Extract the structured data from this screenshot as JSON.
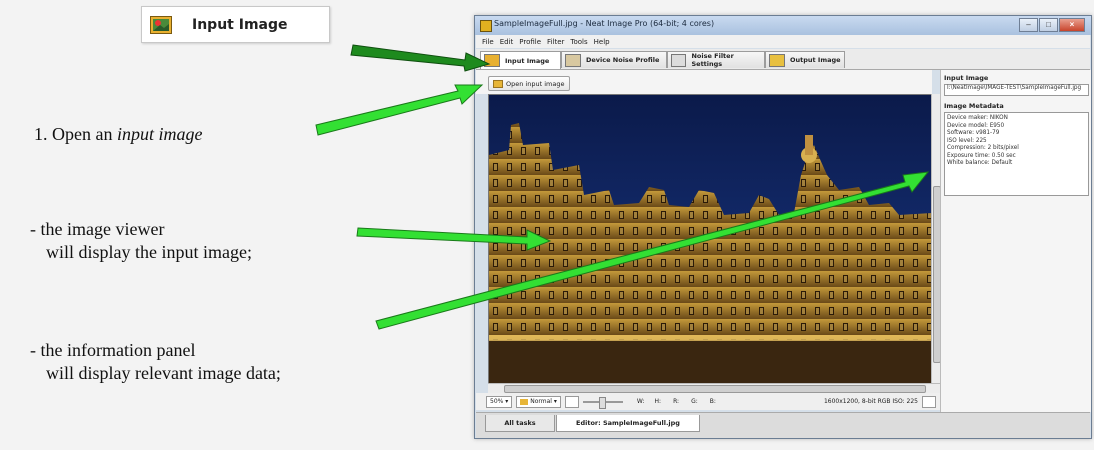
{
  "callout": {
    "label": "Input Image"
  },
  "steps": {
    "step1_prefix": "1. Open an ",
    "step1_em": "input image",
    "viewer_line1": "- the image viewer",
    "viewer_line2": "will display the input image;",
    "panel_line1": "- the information panel",
    "panel_line2": "will display relevant image data;"
  },
  "window": {
    "title": "SampleImageFull.jpg - Neat Image Pro (64-bit; 4 cores)",
    "menu": [
      "File",
      "Edit",
      "Profile",
      "Filter",
      "Tools",
      "Help"
    ],
    "tabs": [
      "Input Image",
      "Device Noise Profile",
      "Noise Filter Settings",
      "Output Image"
    ],
    "open_button": "Open input image",
    "status": {
      "zoom": "50%",
      "mode": "Normal",
      "w": "W:",
      "h": "H:",
      "r": "R:",
      "g": "G:",
      "b": "B:",
      "info": "1600x1200, 8-bit RGB  ISO: 225"
    },
    "task_tabs": [
      "All tasks",
      "Editor: SampleImageFull.jpg"
    ],
    "panel": {
      "input_heading": "Input Image",
      "input_path": "I:\\NeatImage\\IMAGE-TEST\\SampleImageFull.jpg",
      "meta_heading": "Image Metadata",
      "meta": [
        "Device maker: NIKON",
        "Device model: E950",
        "Software: v981-79",
        "ISO level: 225",
        "Compression: 2 bits/pixel",
        "Exposure time: 0.50 sec",
        "White balance: Default"
      ]
    }
  },
  "colors": {
    "arrow_green": "#33e033",
    "arrow_dark_green": "#1e8a1e"
  }
}
